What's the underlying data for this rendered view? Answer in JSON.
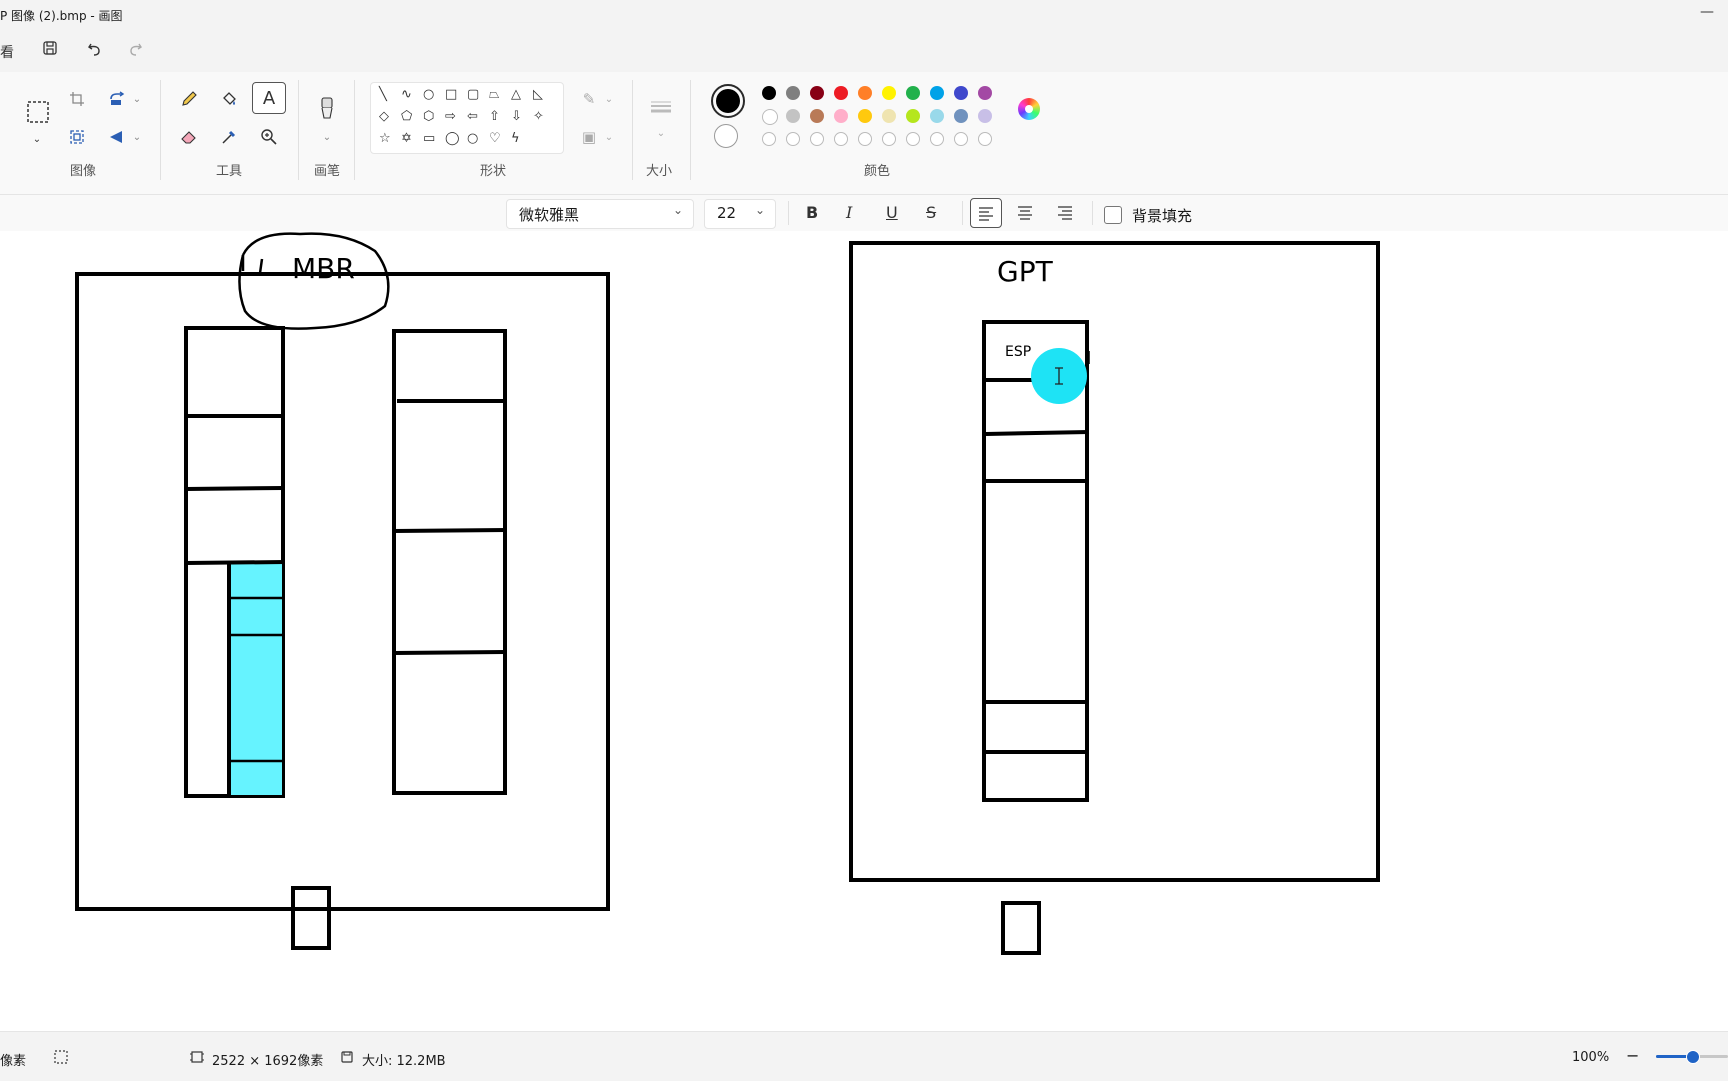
{
  "window": {
    "title": "P 图像 (2).bmp - 画图",
    "minimize": "—"
  },
  "quick": {
    "view_label": "看",
    "save_icon": "save-icon",
    "undo_icon": "undo-icon",
    "redo_icon": "redo-icon"
  },
  "ribbon": {
    "groups": {
      "image": "图像",
      "tools": "工具",
      "brushes": "画笔",
      "shapes": "形状",
      "size": "大小",
      "colors": "颜色"
    },
    "primary_color": "#000000",
    "secondary_color": "#ffffff",
    "palette_row1": [
      "#000000",
      "#7f7f7f",
      "#880015",
      "#ed1c24",
      "#ff7f27",
      "#fff200",
      "#22b14c",
      "#00a2e8",
      "#3f48cc",
      "#a349a4"
    ],
    "palette_row2": [
      "#ffffff",
      "#c3c3c3",
      "#b97a57",
      "#ffaec9",
      "#ffc90e",
      "#efe4b0",
      "#b5e61d",
      "#99d9ea",
      "#7092be",
      "#c8bfe7"
    ]
  },
  "text_toolbar": {
    "font": "微软雅黑",
    "size": "22",
    "bold": "B",
    "italic": "I",
    "underline": "U",
    "strike": "S",
    "background_fill": "背景填充"
  },
  "canvas": {
    "mbr_label": "MBR",
    "gpt_label": "GPT",
    "esp_label": "ESP",
    "highlight_color": "#66f3ff",
    "cursor_color": "#1ee3f5"
  },
  "status": {
    "pixels_label": "像素",
    "dimensions": "2522 × 1692像素",
    "size": "大小: 12.2MB",
    "zoom": "100%",
    "zoom_level": 0.5
  }
}
